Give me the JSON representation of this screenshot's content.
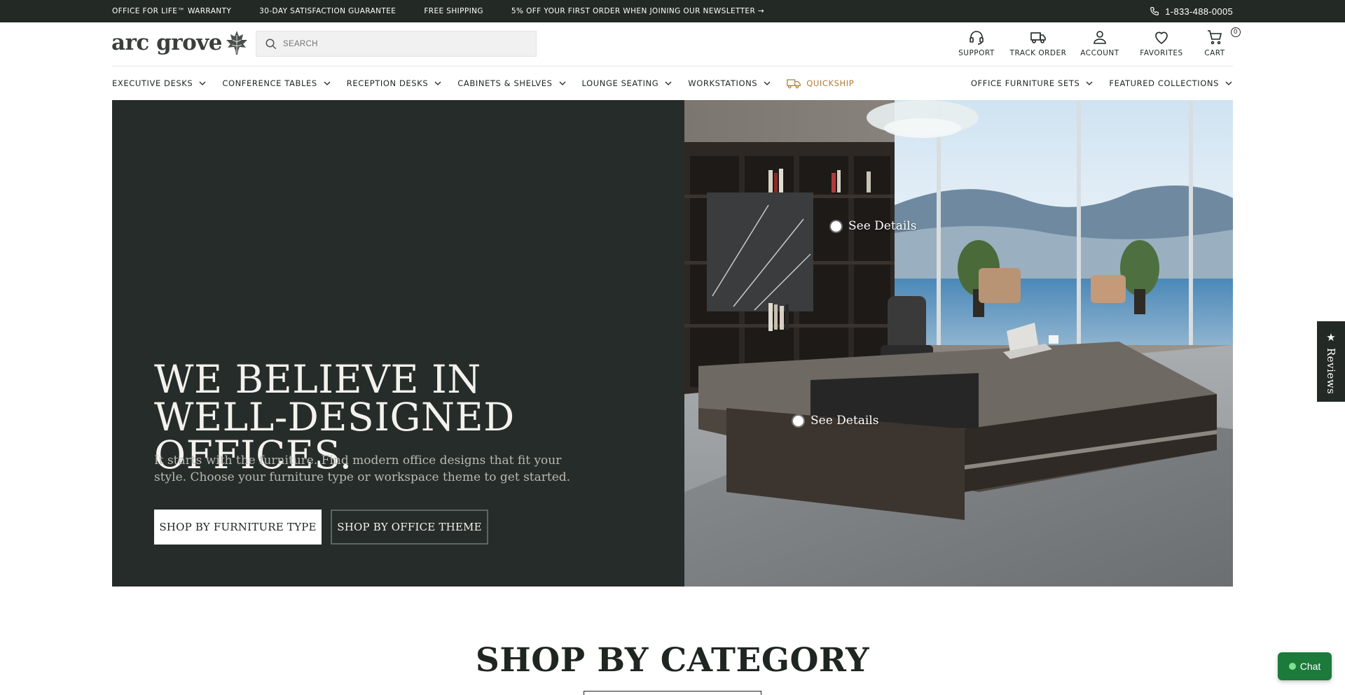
{
  "announcement": {
    "messages": [
      "OFFICE FOR LIFE™ WARRANTY",
      "30-DAY SATISFACTION GUARANTEE",
      "FREE SHIPPING",
      "5% OFF YOUR FIRST ORDER WHEN JOINING OUR NEWSLETTER →"
    ],
    "phone": "1-833-488-0005"
  },
  "header": {
    "logo_text": "arc grove",
    "search_placeholder": "SEARCH",
    "icons": {
      "support": "SUPPORT",
      "track_order": "TRACK ORDER",
      "account": "ACCOUNT",
      "favorites": "FAVORITES",
      "cart": "CART",
      "cart_count": "0"
    }
  },
  "nav": {
    "left": [
      "EXECUTIVE DESKS",
      "CONFERENCE TABLES",
      "RECEPTION DESKS",
      "CABINETS & SHELVES",
      "LOUNGE SEATING",
      "WORKSTATIONS"
    ],
    "quickship": "QUICKSHIP",
    "right": [
      "OFFICE FURNITURE SETS",
      "FEATURED COLLECTIONS"
    ]
  },
  "hero": {
    "headline": "WE BELIEVE IN WELL-DESIGNED OFFICES.",
    "subtext": "It starts with the furniture. Find modern office designs that fit your style. Choose your furniture type or workspace theme to get started.",
    "primary_button": "SHOP BY FURNITURE TYPE",
    "secondary_button": "SHOP BY OFFICE THEME",
    "hotspots": [
      "See Details",
      "See Details"
    ]
  },
  "sections": {
    "category_title": "SHOP BY CATEGORY"
  },
  "widgets": {
    "reviews": "Reviews",
    "chat": "Chat"
  },
  "colors": {
    "dark_green": "#232a26",
    "hero_panel": "#262c29",
    "quickship_accent": "#b07c3a",
    "chat_green": "#1c7a3b"
  }
}
